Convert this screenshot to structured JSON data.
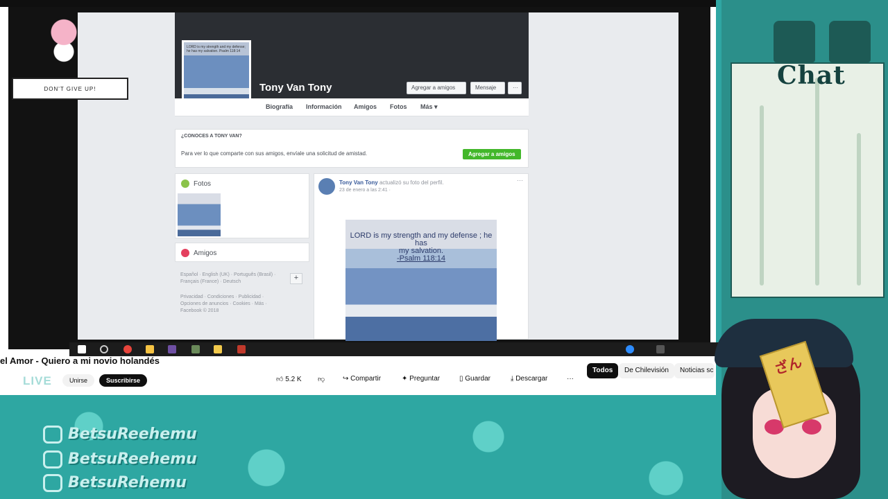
{
  "video": {
    "title": "el Amor - Quiero a mi novio holandés",
    "live_label": "LIVE",
    "join_label": "Unirse",
    "subscribe_label": "Suscribirse",
    "likes": "5.2 K",
    "share_label": "Compartir",
    "ask_label": "Preguntar",
    "save_label": "Guardar",
    "download_label": "Descargar",
    "chips": [
      "Todos",
      "De Chilevisión",
      "Noticias sc"
    ]
  },
  "facebook": {
    "profile_name": "Tony Van Tony",
    "add_friend_label": "Agregar a amigos",
    "message_label": "Mensaje",
    "more_dots": "···",
    "nav": [
      "Biografía",
      "Información",
      "Amigos",
      "Fotos",
      "Más ▾"
    ],
    "know_header": "¿CONOCES A TONY VAN?",
    "know_text": "Para ver lo que comparte con sus amigos, envíale una solicitud de amistad.",
    "add_friend_green": "Agregar a amigos",
    "photos_label": "Fotos",
    "friends_label": "Amigos",
    "languages": "Español · English (UK) · Português (Brasil) · Français (France) · Deutsch",
    "footer": "Privacidad · Condiciones · Publicidad · Opciones de anuncios · Cookies · Más · Facebook © 2018",
    "post_author": "Tony Van Tony",
    "post_action": "actualizó su foto del perfil.",
    "post_date": "23 de enero a las 2:41 ·",
    "post_image_line1": "LORD is my strength and my defense ; he has",
    "post_image_line2": "my salvation.",
    "post_image_line3": "-Psalm 118:14",
    "profile_pic_text": "LORD is my strength and my defense; he has my salvation. Psalm 118:14"
  },
  "overlay": {
    "dont_give_up": "DON'T GIVE UP!",
    "chat_title": "Chat",
    "socials": [
      "BetsuReehemu",
      "BetsuReehemu",
      "BetsuRehemu"
    ],
    "talisman": "ざん"
  },
  "colors": {
    "teal": "#2ea7a2",
    "fb_green": "#42b72a",
    "yt_dark": "#0f0f0f"
  }
}
